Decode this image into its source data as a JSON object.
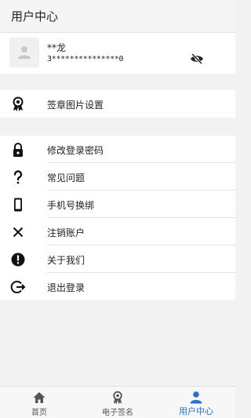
{
  "header": {
    "title": "用户中心"
  },
  "profile": {
    "name": "**龙",
    "masked_phone": "3***************0"
  },
  "menu_top": [
    {
      "label": "签章图片设置",
      "icon": "seal-ribbon-icon"
    }
  ],
  "menu_main": [
    {
      "label": "修改登录密码",
      "icon": "lock-icon"
    },
    {
      "label": "常见问题",
      "icon": "question-icon"
    },
    {
      "label": "手机号换绑",
      "icon": "phone-icon"
    },
    {
      "label": "注销账户",
      "icon": "close-icon"
    },
    {
      "label": "关于我们",
      "icon": "info-exclamation-icon"
    },
    {
      "label": "退出登录",
      "icon": "logout-icon"
    }
  ],
  "tabs": [
    {
      "label": "首页",
      "icon": "home-icon",
      "active": false
    },
    {
      "label": "电子签名",
      "icon": "seal-ribbon-icon",
      "active": false
    },
    {
      "label": "用户中心",
      "icon": "user-icon",
      "active": true
    }
  ],
  "colors": {
    "accent": "#2e6ec8",
    "background": "#f2f2f2",
    "separator": "#e4e4e4"
  }
}
